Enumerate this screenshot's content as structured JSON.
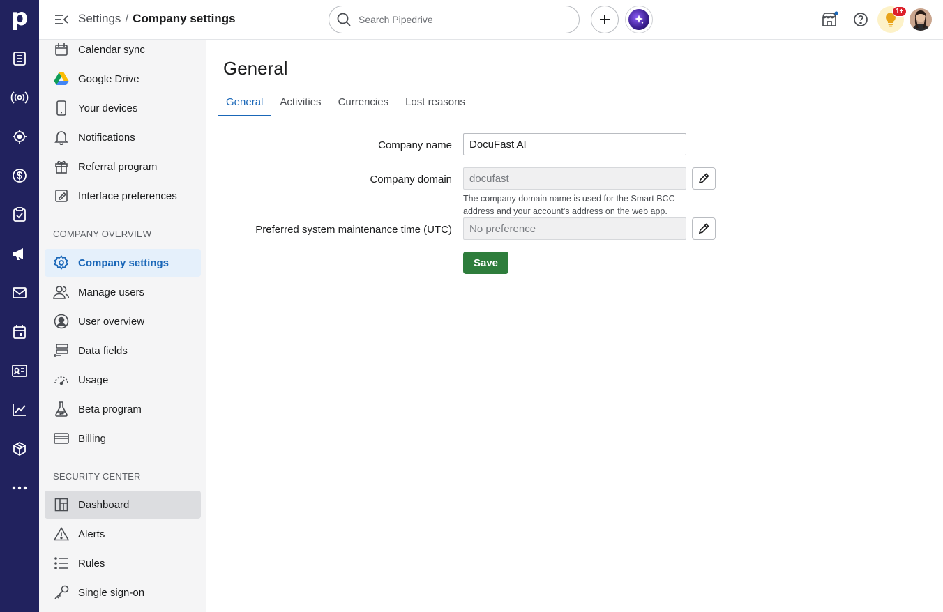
{
  "brand": {
    "logo_letter": "p",
    "rail_color": "#21225e",
    "accent": "#1a67b8",
    "save_color": "#2e7d3c"
  },
  "rail": [
    {
      "name": "deals-icon"
    },
    {
      "name": "leads-icon"
    },
    {
      "name": "target-icon"
    },
    {
      "name": "dollar-icon"
    },
    {
      "name": "tasks-icon"
    },
    {
      "name": "campaigns-icon"
    },
    {
      "name": "mail-icon"
    },
    {
      "name": "calendar-icon"
    },
    {
      "name": "contacts-icon"
    },
    {
      "name": "insights-icon"
    },
    {
      "name": "products-icon"
    },
    {
      "name": "more-icon"
    }
  ],
  "topbar": {
    "breadcrumb_parent": "Settings",
    "breadcrumb_sep": "/",
    "breadcrumb_current": "Company settings",
    "search_placeholder": "Search Pipedrive",
    "notification_badge": "1+"
  },
  "sidebar": {
    "items_top": [
      {
        "label": "Calendar sync",
        "icon": "calendar-icon"
      },
      {
        "label": "Google Drive",
        "icon": "google-drive-icon"
      },
      {
        "label": "Your devices",
        "icon": "phone-icon"
      },
      {
        "label": "Notifications",
        "icon": "bell-icon"
      },
      {
        "label": "Referral program",
        "icon": "gift-icon"
      },
      {
        "label": "Interface preferences",
        "icon": "interface-icon"
      }
    ],
    "company_overview_title": "COMPANY OVERVIEW",
    "company_items": [
      {
        "label": "Company settings",
        "icon": "gear-icon"
      },
      {
        "label": "Manage users",
        "icon": "users-icon"
      },
      {
        "label": "User overview",
        "icon": "user-circle-icon"
      },
      {
        "label": "Data fields",
        "icon": "data-fields-icon"
      },
      {
        "label": "Usage",
        "icon": "gauge-icon"
      },
      {
        "label": "Beta program",
        "icon": "flask-icon"
      },
      {
        "label": "Billing",
        "icon": "card-icon"
      }
    ],
    "security_center_title": "SECURITY CENTER",
    "security_items": [
      {
        "label": "Dashboard",
        "icon": "dashboard-icon"
      },
      {
        "label": "Alerts",
        "icon": "warning-icon"
      },
      {
        "label": "Rules",
        "icon": "list-icon"
      },
      {
        "label": "Single sign-on",
        "icon": "key-icon"
      }
    ]
  },
  "main": {
    "title": "General",
    "tabs": [
      "General",
      "Activities",
      "Currencies",
      "Lost reasons"
    ],
    "form": {
      "company_name_label": "Company name",
      "company_name_value": "DocuFast AI",
      "company_domain_label": "Company domain",
      "company_domain_value": "docufast",
      "domain_hint": "The company domain name is used for the Smart BCC address and your account's address on the web app.",
      "maintenance_label": "Preferred system maintenance time (UTC)",
      "maintenance_value": "No preference",
      "save_label": "Save"
    }
  }
}
